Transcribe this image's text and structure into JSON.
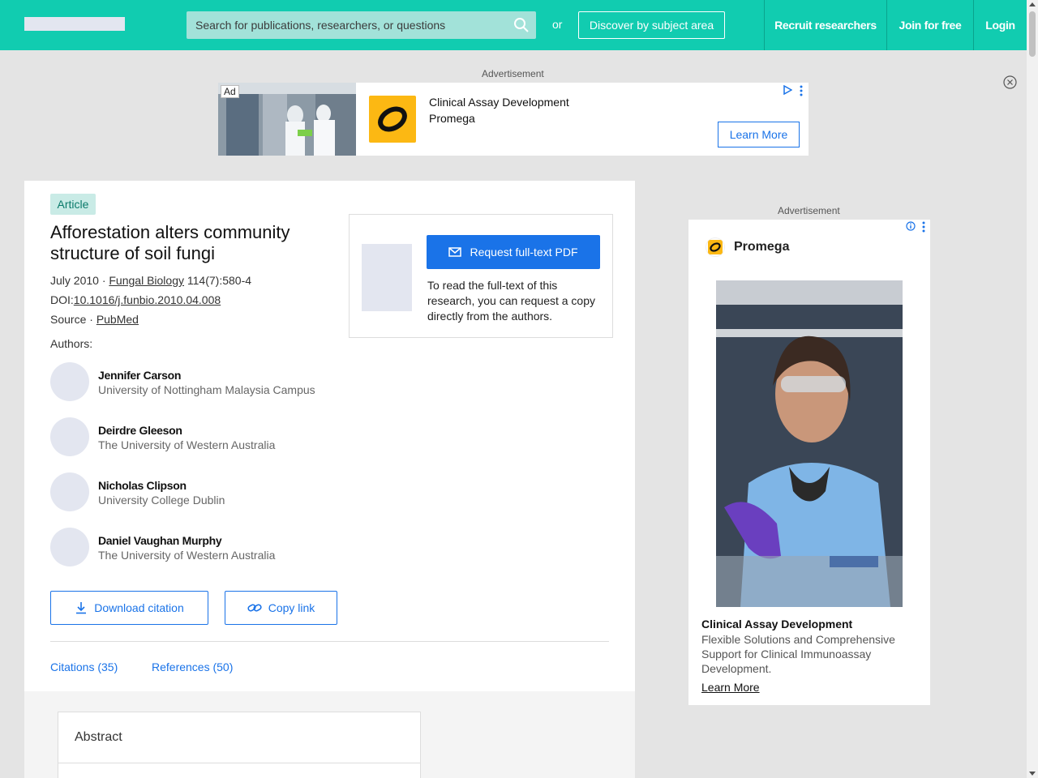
{
  "header": {
    "search_placeholder": "Search for publications, researchers, or questions",
    "or_text": "or",
    "discover_label": "Discover by subject area",
    "nav": [
      "Recruit researchers",
      "Join for free",
      "Login"
    ]
  },
  "ads": {
    "label": "Advertisement",
    "top": {
      "badge": "Ad",
      "line1": "Clinical Assay Development",
      "line2": "Promega",
      "cta": "Learn More"
    },
    "side": {
      "brand": "Promega",
      "headline": "Clinical Assay Development",
      "description": "Flexible Solutions and Comprehensive Support for Clinical Immunoassay Development.",
      "cta": "Learn More"
    }
  },
  "article": {
    "type": "Article",
    "title": "Afforestation alters community structure of soil fungi",
    "date_prefix": "July 2010 · ",
    "journal": "Fungal Biology",
    "volume": " 114(7):580-4",
    "doi_prefix": "DOI:",
    "doi": "10.1016/j.funbio.2010.04.008",
    "source_prefix": "Source · ",
    "source": "PubMed",
    "authors_label": "Authors:",
    "authors": [
      {
        "name": "Jennifer Carson",
        "institution": "University of Nottingham Malaysia Campus"
      },
      {
        "name": "Deirdre Gleeson",
        "institution": "The University of Western Australia"
      },
      {
        "name": "Nicholas Clipson",
        "institution": "University College Dublin"
      },
      {
        "name": "Daniel Vaughan Murphy",
        "institution": "The University of Western Australia"
      }
    ],
    "download_citation": "Download citation",
    "copy_link": "Copy link",
    "tabs": [
      "Citations (35)",
      "References (50)"
    ],
    "abstract_heading": "Abstract"
  },
  "fulltext": {
    "button": "Request full-text PDF",
    "description": "To read the full-text of this research, you can request a copy directly from the authors."
  },
  "colors": {
    "brand": "#11ccb0",
    "link": "#1a73e8",
    "promega_yellow": "#fcb813"
  }
}
